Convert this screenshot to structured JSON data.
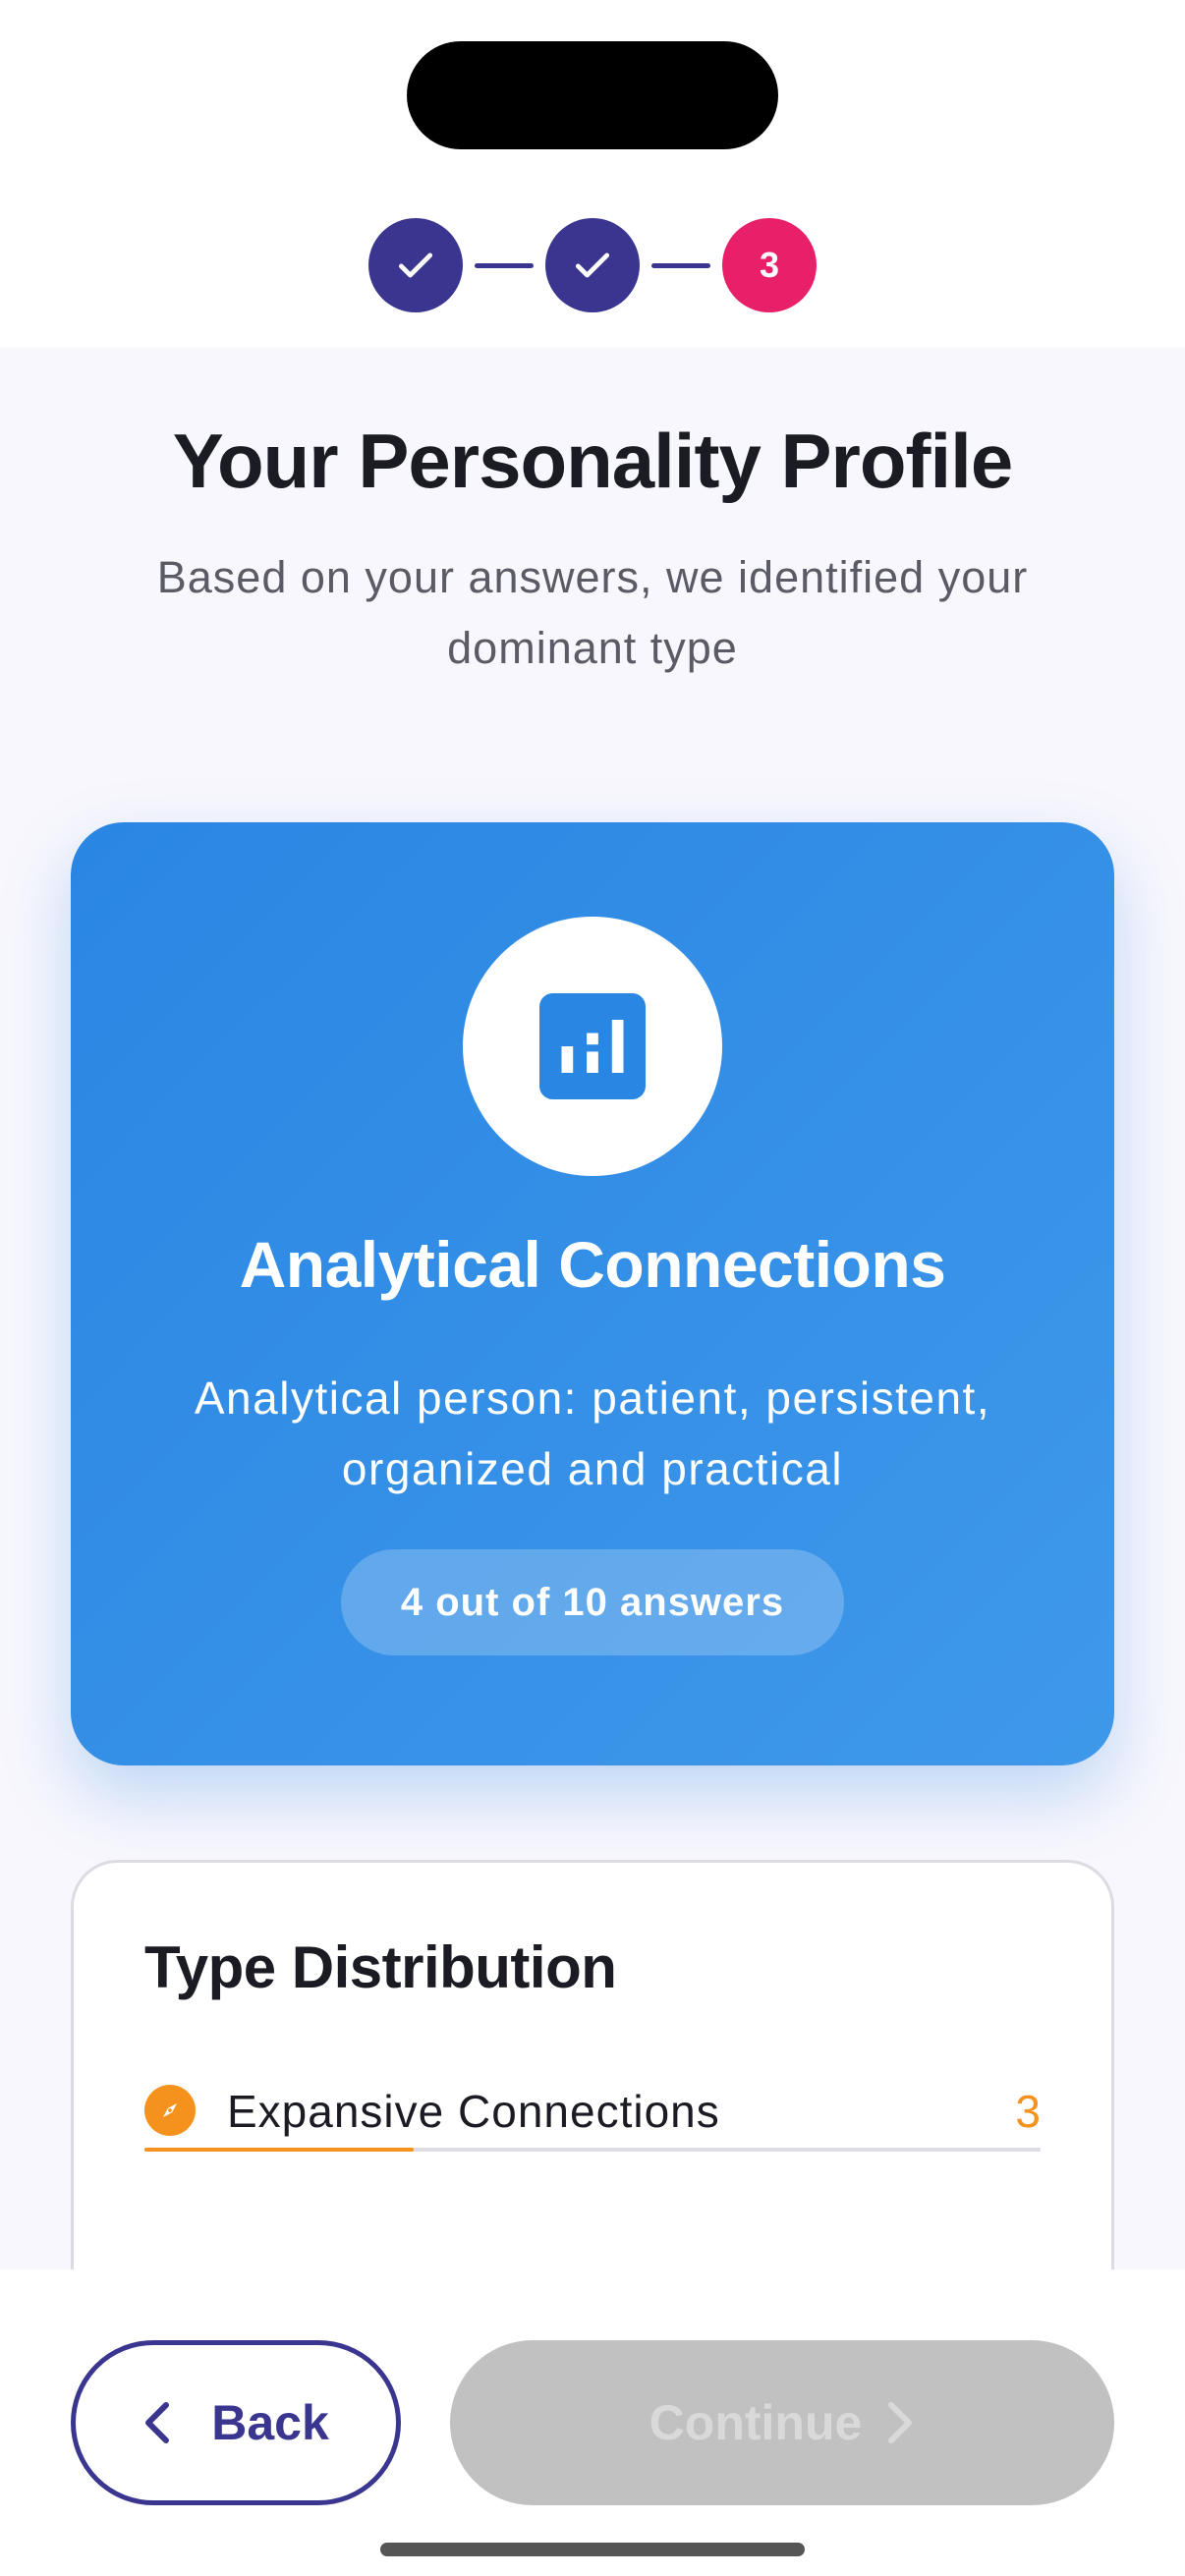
{
  "stepper": {
    "steps": [
      {
        "state": "completed",
        "icon": "check-icon"
      },
      {
        "state": "completed",
        "icon": "check-icon"
      },
      {
        "state": "current",
        "label": "3"
      }
    ],
    "colors": {
      "completed": "#3a3690",
      "current": "#e8206a"
    }
  },
  "header": {
    "title": "Your Personality Profile",
    "subtitle": "Based on your answers, we identified your dominant type"
  },
  "result": {
    "icon": "bar-chart-icon",
    "type_name": "Analytical Connections",
    "description": "Analytical person: patient, persistent, organized and practical",
    "badge": "4 out of 10 answers",
    "color": "#2a86e3"
  },
  "distribution": {
    "title": "Type Distribution",
    "items": [
      {
        "icon": "compass-icon",
        "label": "Expansive Connections",
        "count": "3",
        "color": "#f5911d",
        "fraction": 0.3
      }
    ]
  },
  "footer": {
    "back_label": "Back",
    "continue_label": "Continue",
    "continue_enabled": false
  }
}
